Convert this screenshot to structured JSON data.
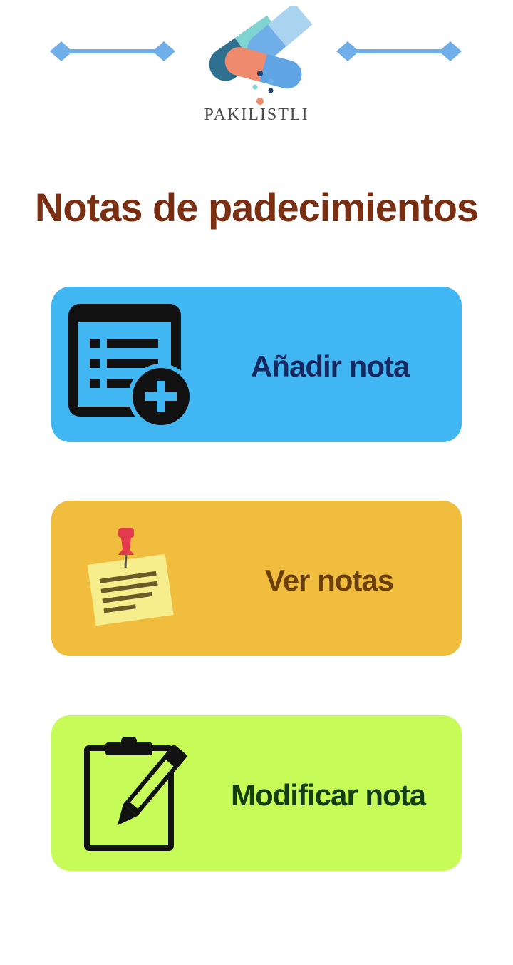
{
  "header": {
    "logo_text": "PAKILISTLI",
    "divider_color": "#6faee8"
  },
  "page": {
    "title": "Notas de padecimientos"
  },
  "actions": [
    {
      "label": "Añadir nota",
      "icon": "add-note-list-icon",
      "color": "#40b7f2"
    },
    {
      "label": "Ver notas",
      "icon": "pinned-note-icon",
      "color": "#f1bd3e"
    },
    {
      "label": "Modificar nota",
      "icon": "edit-clipboard-icon",
      "color": "#c6fb58"
    }
  ]
}
